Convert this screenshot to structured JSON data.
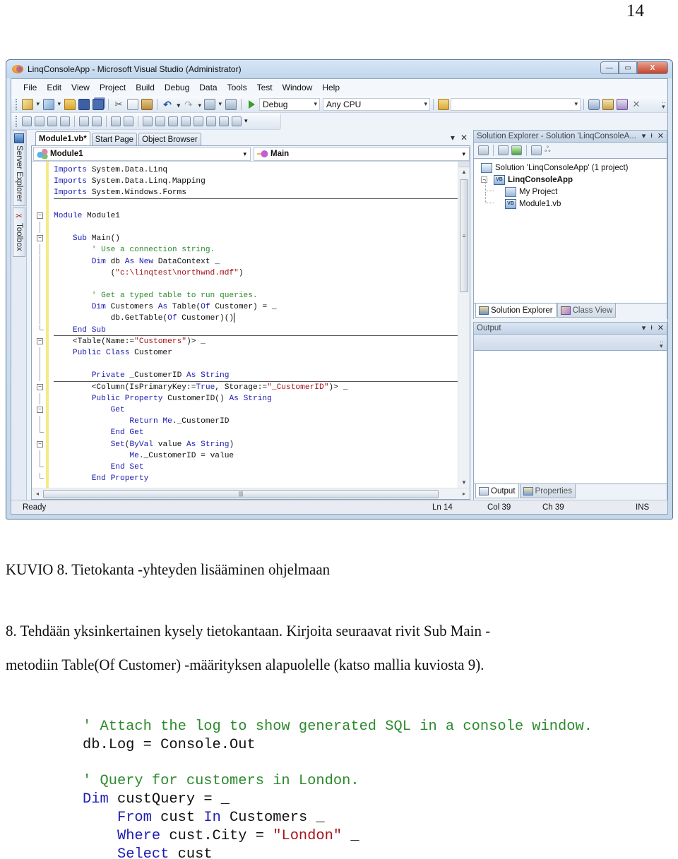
{
  "page": {
    "number": "14"
  },
  "window": {
    "title": "LinqConsoleApp - Microsoft Visual Studio (Administrator)",
    "controls": {
      "minimize": "—",
      "maximize": "▭",
      "close": "X"
    }
  },
  "menubar": [
    "File",
    "Edit",
    "View",
    "Project",
    "Build",
    "Debug",
    "Data",
    "Tools",
    "Test",
    "Window",
    "Help"
  ],
  "toolbar": {
    "configuration": "Debug",
    "platform": "Any CPU",
    "find_value": ""
  },
  "left_rail": {
    "server_explorer": "Server Explorer",
    "toolbox": "Toolbox"
  },
  "editor": {
    "tabs": [
      {
        "label": "Module1.vb*",
        "active": true
      },
      {
        "label": "Start Page",
        "active": false
      },
      {
        "label": "Object Browser",
        "active": false
      }
    ],
    "tab_controls": {
      "dropdown": "▾",
      "close": "✕"
    },
    "nav_left": "Module1",
    "nav_right": "Main",
    "lines": [
      [
        {
          "t": "kw",
          "v": "Imports"
        },
        {
          "t": "tx",
          "v": " System.Data.Linq"
        }
      ],
      [
        {
          "t": "kw",
          "v": "Imports"
        },
        {
          "t": "tx",
          "v": " System.Data.Linq.Mapping"
        }
      ],
      [
        {
          "t": "kw",
          "v": "Imports"
        },
        {
          "t": "tx",
          "v": " System.Windows.Forms"
        }
      ],
      [],
      [
        {
          "t": "kw",
          "v": "Module"
        },
        {
          "t": "tx",
          "v": " Module1"
        }
      ],
      [],
      [
        {
          "t": "tx",
          "v": "    "
        },
        {
          "t": "kw",
          "v": "Sub"
        },
        {
          "t": "tx",
          "v": " Main()"
        }
      ],
      [
        {
          "t": "tx",
          "v": "        "
        },
        {
          "t": "cm",
          "v": "' Use a connection string."
        }
      ],
      [
        {
          "t": "tx",
          "v": "        "
        },
        {
          "t": "kw",
          "v": "Dim"
        },
        {
          "t": "tx",
          "v": " db "
        },
        {
          "t": "kw",
          "v": "As New"
        },
        {
          "t": "tx",
          "v": " DataContext _"
        }
      ],
      [
        {
          "t": "tx",
          "v": "            ("
        },
        {
          "t": "st",
          "v": "\"c:\\linqtest\\northwnd.mdf\""
        },
        {
          "t": "tx",
          "v": ")"
        }
      ],
      [],
      [
        {
          "t": "tx",
          "v": "        "
        },
        {
          "t": "cm",
          "v": "' Get a typed table to run queries."
        }
      ],
      [
        {
          "t": "tx",
          "v": "        "
        },
        {
          "t": "kw",
          "v": "Dim"
        },
        {
          "t": "tx",
          "v": " Customers "
        },
        {
          "t": "kw",
          "v": "As"
        },
        {
          "t": "tx",
          "v": " Table("
        },
        {
          "t": "kw",
          "v": "Of"
        },
        {
          "t": "tx",
          "v": " Customer) = _"
        }
      ],
      [
        {
          "t": "tx",
          "v": "            db.GetTable("
        },
        {
          "t": "kw",
          "v": "Of"
        },
        {
          "t": "tx",
          "v": " Customer)()"
        }
      ],
      [
        {
          "t": "tx",
          "v": "    "
        },
        {
          "t": "kw",
          "v": "End Sub"
        }
      ],
      [
        {
          "t": "tx",
          "v": "    <Table(Name:="
        },
        {
          "t": "st",
          "v": "\"Customers\""
        },
        {
          "t": "tx",
          "v": ")> _"
        }
      ],
      [
        {
          "t": "tx",
          "v": "    "
        },
        {
          "t": "kw",
          "v": "Public Class"
        },
        {
          "t": "tx",
          "v": " Customer"
        }
      ],
      [],
      [
        {
          "t": "tx",
          "v": "        "
        },
        {
          "t": "kw",
          "v": "Private"
        },
        {
          "t": "tx",
          "v": " _CustomerID "
        },
        {
          "t": "kw",
          "v": "As String"
        }
      ],
      [
        {
          "t": "tx",
          "v": "        <Column(IsPrimaryKey:="
        },
        {
          "t": "kw",
          "v": "True"
        },
        {
          "t": "tx",
          "v": ", Storage:="
        },
        {
          "t": "st",
          "v": "\"_CustomerID\""
        },
        {
          "t": "tx",
          "v": ")> _"
        }
      ],
      [
        {
          "t": "tx",
          "v": "        "
        },
        {
          "t": "kw",
          "v": "Public Property"
        },
        {
          "t": "tx",
          "v": " CustomerID() "
        },
        {
          "t": "kw",
          "v": "As String"
        }
      ],
      [
        {
          "t": "tx",
          "v": "            "
        },
        {
          "t": "kw",
          "v": "Get"
        }
      ],
      [
        {
          "t": "tx",
          "v": "                "
        },
        {
          "t": "kw",
          "v": "Return Me"
        },
        {
          "t": "tx",
          "v": "._CustomerID"
        }
      ],
      [
        {
          "t": "tx",
          "v": "            "
        },
        {
          "t": "kw",
          "v": "End Get"
        }
      ],
      [
        {
          "t": "tx",
          "v": "            "
        },
        {
          "t": "kw",
          "v": "Set"
        },
        {
          "t": "tx",
          "v": "("
        },
        {
          "t": "kw",
          "v": "ByVal"
        },
        {
          "t": "tx",
          "v": " value "
        },
        {
          "t": "kw",
          "v": "As String"
        },
        {
          "t": "tx",
          "v": ")"
        }
      ],
      [
        {
          "t": "tx",
          "v": "                "
        },
        {
          "t": "kw",
          "v": "Me"
        },
        {
          "t": "tx",
          "v": "._CustomerID = value"
        }
      ],
      [
        {
          "t": "tx",
          "v": "            "
        },
        {
          "t": "kw",
          "v": "End Set"
        }
      ],
      [
        {
          "t": "tx",
          "v": "        "
        },
        {
          "t": "kw",
          "v": "End Property"
        }
      ]
    ],
    "caret_line": 13
  },
  "solution_explorer": {
    "title": "Solution Explorer - Solution 'LinqConsoleA...",
    "tree": [
      {
        "label": "Solution 'LinqConsoleApp' (1 project)",
        "level": 0,
        "icon": "solution-icon",
        "bold": false
      },
      {
        "label": "LinqConsoleApp",
        "level": 1,
        "icon": "vb-project-icon",
        "bold": true
      },
      {
        "label": "My Project",
        "level": 2,
        "icon": "my-project-icon",
        "bold": false
      },
      {
        "label": "Module1.vb",
        "level": 2,
        "icon": "vb-file-icon",
        "bold": false
      }
    ],
    "tabs": [
      {
        "label": "Solution Explorer",
        "active": true
      },
      {
        "label": "Class View",
        "active": false
      }
    ]
  },
  "output_panel": {
    "title": "Output",
    "tabs": [
      {
        "label": "Output",
        "active": true
      },
      {
        "label": "Properties",
        "active": false
      }
    ]
  },
  "panel_controls": {
    "dropdown": "▾",
    "pin": "ᵻ",
    "close": "✕"
  },
  "statusbar": {
    "ready": "Ready",
    "line": "Ln 14",
    "col": "Col 39",
    "ch": "Ch 39",
    "mode": "INS"
  },
  "document": {
    "caption": "KUVIO 8. Tietokanta -yhteyden lisääminen ohjelmaan",
    "paragraph_line1": "8. Tehdään yksinkertainen kysely tietokantaan. Kirjoita seuraavat rivit Sub Main -",
    "paragraph_line2": "metodiin Table(Of Customer) -määrityksen alapuolelle (katso mallia kuviosta 9).",
    "snippet": [
      [
        {
          "t": "cm",
          "v": "' Attach the log to show generated SQL in a console window."
        }
      ],
      [
        {
          "t": "tx",
          "v": "db.Log = Console.Out"
        }
      ],
      [],
      [
        {
          "t": "cm",
          "v": "' Query for customers in London."
        }
      ],
      [
        {
          "t": "kw",
          "v": "Dim"
        },
        {
          "t": "tx",
          "v": " custQuery = _"
        }
      ],
      [
        {
          "t": "tx",
          "v": "    "
        },
        {
          "t": "kw",
          "v": "From"
        },
        {
          "t": "tx",
          "v": " cust "
        },
        {
          "t": "kw",
          "v": "In"
        },
        {
          "t": "tx",
          "v": " Customers _"
        }
      ],
      [
        {
          "t": "tx",
          "v": "    "
        },
        {
          "t": "kw",
          "v": "Where"
        },
        {
          "t": "tx",
          "v": " cust.City = "
        },
        {
          "t": "st",
          "v": "\"London\""
        },
        {
          "t": "tx",
          "v": " _"
        }
      ],
      [
        {
          "t": "tx",
          "v": "    "
        },
        {
          "t": "kw",
          "v": "Select"
        },
        {
          "t": "tx",
          "v": " cust"
        }
      ]
    ]
  }
}
